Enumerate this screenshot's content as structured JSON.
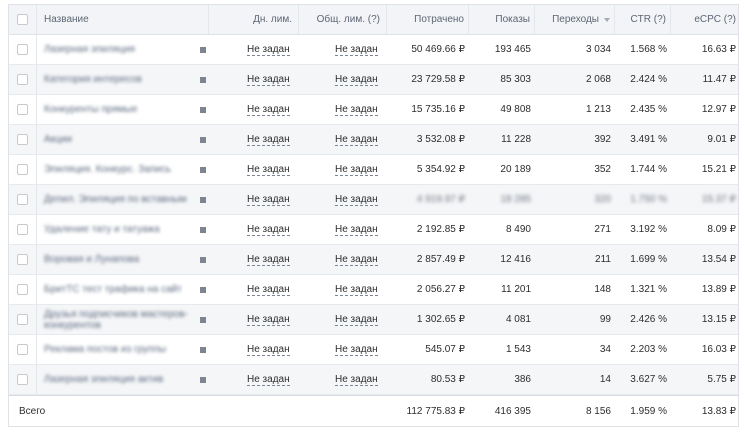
{
  "headers": {
    "name": "Название",
    "day_limit": "Дн. лим.",
    "total_limit": "Общ. лим. (?)",
    "spent": "Потрачено",
    "impressions": "Показы",
    "clicks": "Переходы",
    "ctr": "CTR (?)",
    "ecpc": "eCPC (?)"
  },
  "rows": [
    {
      "name": "Лазерная эпиляция",
      "day_limit": "Не задан",
      "total_limit": "Не задан",
      "spent": "50 469.66 ₽",
      "impressions": "193 465",
      "clicks": "3 034",
      "ctr": "1.568 %",
      "ecpc": "16.63 ₽",
      "blurred": false
    },
    {
      "name": "Категория интересов",
      "day_limit": "Не задан",
      "total_limit": "Не задан",
      "spent": "23 729.58 ₽",
      "impressions": "85 303",
      "clicks": "2 068",
      "ctr": "2.424 %",
      "ecpc": "11.47 ₽",
      "blurred": false
    },
    {
      "name": "Конкуренты прямые",
      "day_limit": "Не задан",
      "total_limit": "Не задан",
      "spent": "15 735.16 ₽",
      "impressions": "49 808",
      "clicks": "1 213",
      "ctr": "2.435 %",
      "ecpc": "12.97 ₽",
      "blurred": false
    },
    {
      "name": "Акции",
      "day_limit": "Не задан",
      "total_limit": "Не задан",
      "spent": "3 532.08 ₽",
      "impressions": "11 228",
      "clicks": "392",
      "ctr": "3.491 %",
      "ecpc": "9.01 ₽",
      "blurred": false
    },
    {
      "name": "Эпиляция. Конкурс. Запись",
      "day_limit": "Не задан",
      "total_limit": "Не задан",
      "spent": "5 354.92 ₽",
      "impressions": "20 189",
      "clicks": "352",
      "ctr": "1.744 %",
      "ecpc": "15.21 ₽",
      "blurred": false
    },
    {
      "name": "Депил. Эпиляция по вставным",
      "day_limit": "Не задан",
      "total_limit": "Не задан",
      "spent": "4 919.97 ₽",
      "impressions": "18 285",
      "clicks": "320",
      "ctr": "1.750 %",
      "ecpc": "15.37 ₽",
      "blurred": true
    },
    {
      "name": "Удаление тату и татуажа",
      "day_limit": "Не задан",
      "total_limit": "Не задан",
      "spent": "2 192.85 ₽",
      "impressions": "8 490",
      "clicks": "271",
      "ctr": "3.192 %",
      "ecpc": "8.09 ₽",
      "blurred": false
    },
    {
      "name": "Воровая и Лунапова",
      "day_limit": "Не задан",
      "total_limit": "Не задан",
      "spent": "2 857.49 ₽",
      "impressions": "12 416",
      "clicks": "211",
      "ctr": "1.699 %",
      "ecpc": "13.54 ₽",
      "blurred": false
    },
    {
      "name": "БритТС тест трафика на сайт",
      "day_limit": "Не задан",
      "total_limit": "Не задан",
      "spent": "2 056.27 ₽",
      "impressions": "11 201",
      "clicks": "148",
      "ctr": "1.321 %",
      "ecpc": "13.89 ₽",
      "blurred": false
    },
    {
      "name": "Друзья подписчиков мастеров-конкурентов",
      "day_limit": "Не задан",
      "total_limit": "Не задан",
      "spent": "1 302.65 ₽",
      "impressions": "4 081",
      "clicks": "99",
      "ctr": "2.426 %",
      "ecpc": "13.15 ₽",
      "blurred": false
    },
    {
      "name": "Реклама постов из группы",
      "day_limit": "Не задан",
      "total_limit": "Не задан",
      "spent": "545.07 ₽",
      "impressions": "1 543",
      "clicks": "34",
      "ctr": "2.203 %",
      "ecpc": "16.03 ₽",
      "blurred": false
    },
    {
      "name": "Лазерная эпиляция актив",
      "day_limit": "Не задан",
      "total_limit": "Не задан",
      "spent": "80.53 ₽",
      "impressions": "386",
      "clicks": "14",
      "ctr": "3.627 %",
      "ecpc": "5.75 ₽",
      "blurred": false
    }
  ],
  "total": {
    "label": "Всего",
    "spent": "112 775.83 ₽",
    "impressions": "416 395",
    "clicks": "8 156",
    "ctr": "1.959 %",
    "ecpc": "13.83 ₽"
  }
}
